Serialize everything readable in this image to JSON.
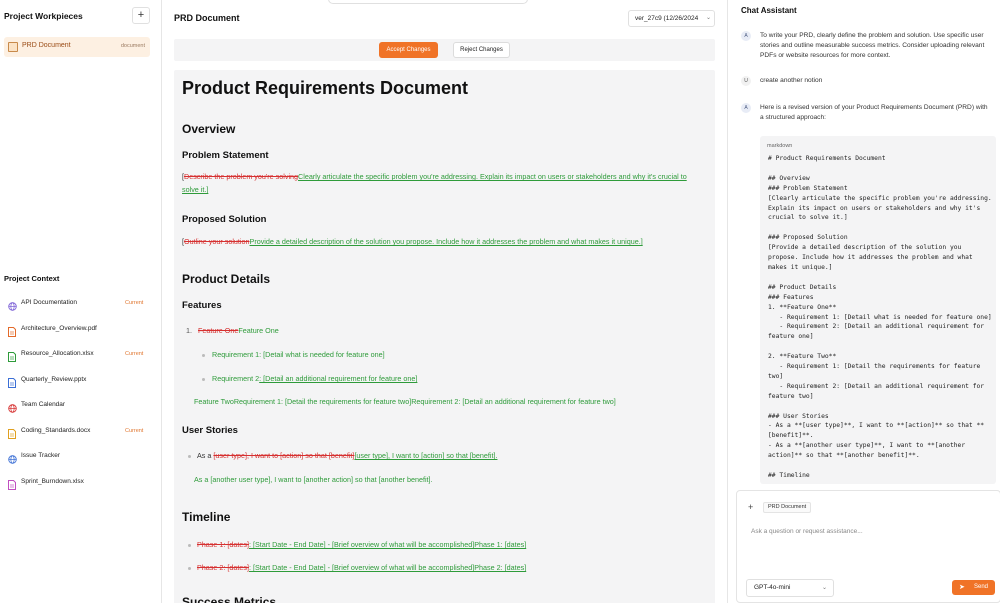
{
  "sidebar": {
    "workpieces_title": "Project Workpieces",
    "add_label": "+",
    "workpiece": {
      "label": "PRD Document",
      "tag": "document"
    },
    "context_title": "Project Context",
    "context_items": [
      {
        "name": "API Documentation",
        "icon": "globe-icon",
        "badge": "Current",
        "color": "#7b5fd6"
      },
      {
        "name": "Architecture_Overview.pdf",
        "icon": "pdf-file-icon",
        "badge": "",
        "color": "#e36a2a"
      },
      {
        "name": "Resource_Allocation.xlsx",
        "icon": "spreadsheet-file-icon",
        "badge": "Current",
        "color": "#2e9b3a"
      },
      {
        "name": "Quarterly_Review.pptx",
        "icon": "presentation-file-icon",
        "badge": "",
        "color": "#3b6fd6"
      },
      {
        "name": "Team Calendar",
        "icon": "globe-icon",
        "badge": "",
        "color": "#d63030"
      },
      {
        "name": "Coding_Standards.docx",
        "icon": "document-file-icon",
        "badge": "Current",
        "color": "#e0a020"
      },
      {
        "name": "Issue Tracker",
        "icon": "globe-icon",
        "badge": "",
        "color": "#3b6fd6"
      },
      {
        "name": "Sprint_Burndown.xlsx",
        "icon": "spreadsheet-file-icon",
        "badge": "",
        "color": "#c04fc0"
      }
    ]
  },
  "main": {
    "title": "PRD Document",
    "version": "ver_27c9 (12/26/2024",
    "accept_label": "Accept Changes",
    "reject_label": "Reject Changes",
    "doc": {
      "h1": "Product Requirements Document",
      "overview": "Overview",
      "problem_statement": "Problem Statement",
      "ps_bracket": "[",
      "ps_del": "Describe the problem you're solving",
      "ps_ins": "Clearly articulate the specific problem you're addressing. Explain its impact on users or stakeholders and why it's crucial to solve it.]",
      "proposed_solution": "Proposed Solution",
      "sol_bracket": "[",
      "sol_del": "Outline your solution",
      "sol_ins": "Provide a detailed description of the solution you propose. Include how it addresses the problem and what makes it unique.]",
      "product_details": "Product Details",
      "features": "Features",
      "f1_num": "1.",
      "f1_del": "Feature One",
      "f1_ins": "Feature One",
      "req1_plain": "Requirement 1: [Detail what is needed for feature one]",
      "req2_plain": "Requirement 2",
      "req2_ins": ": [Detail an additional requirement for feature one]",
      "f2_line": "Feature TwoRequirement 1: [Detail the requirements for feature two]Requirement 2: [Detail an additional requirement for feature two]",
      "user_stories": "User Stories",
      "us1_plain": "As a ",
      "us1_del": "[user type], I want to [action] so that [benefit]",
      "us1_ins": "[user type], I want to [action] so that [benefit].",
      "us2_ins": "As a [another user type], I want to [another action] so that [another benefit].",
      "timeline": "Timeline",
      "t1_del": "Phase 1: [dates]",
      "t1_ins": ": [Start Date - End Date] - [Brief overview of what will be accomplished]Phase 1: [dates]",
      "t2_del": "Phase 2: [dates]",
      "t2_ins": ": [Start Date - End Date] - [Brief overview of what will be accomplished]Phase 2: [dates]",
      "success_metrics": "Success Metrics"
    }
  },
  "chat": {
    "title": "Chat Assistant",
    "messages": [
      {
        "avatar": "A",
        "text": "To write your PRD, clearly define the problem and solution. Use specific user stories and outline measurable success metrics. Consider uploading relevant PDFs or website resources for more context."
      },
      {
        "avatar": "U",
        "text": "create another notion"
      },
      {
        "avatar": "A",
        "text": "Here is a revised version of your Product Requirements Document (PRD) with a structured approach:"
      }
    ],
    "code_lang": "markdown",
    "code": "# Product Requirements Document\n\n## Overview\n### Problem Statement\n[Clearly articulate the specific problem you're addressing. Explain its impact on users or stakeholders and why it's crucial to solve it.]\n\n### Proposed Solution\n[Provide a detailed description of the solution you propose. Include how it addresses the problem and what makes it unique.]\n\n## Product Details\n### Features\n1. **Feature One**\n   - Requirement 1: [Detail what is needed for feature one]\n   - Requirement 2: [Detail an additional requirement for feature one]\n\n2. **Feature Two**\n   - Requirement 1: [Detail the requirements for feature two]\n   - Requirement 2: [Detail an additional requirement for feature two]\n\n### User Stories\n- As a **[user type]**, I want to **[action]** so that **[benefit]**.\n- As a **[another user type]**, I want to **[another action]** so that **[another benefit]**.\n\n## Timeline",
    "composer": {
      "plus_label": "+",
      "chip": "PRD Document",
      "placeholder": "Ask a question or request assistance...",
      "model": "GPT-4o-mini",
      "send_label": "Send"
    }
  },
  "colors": {
    "accent": "#f07327",
    "deleted": "#d63030",
    "inserted": "#2e9b3a"
  }
}
